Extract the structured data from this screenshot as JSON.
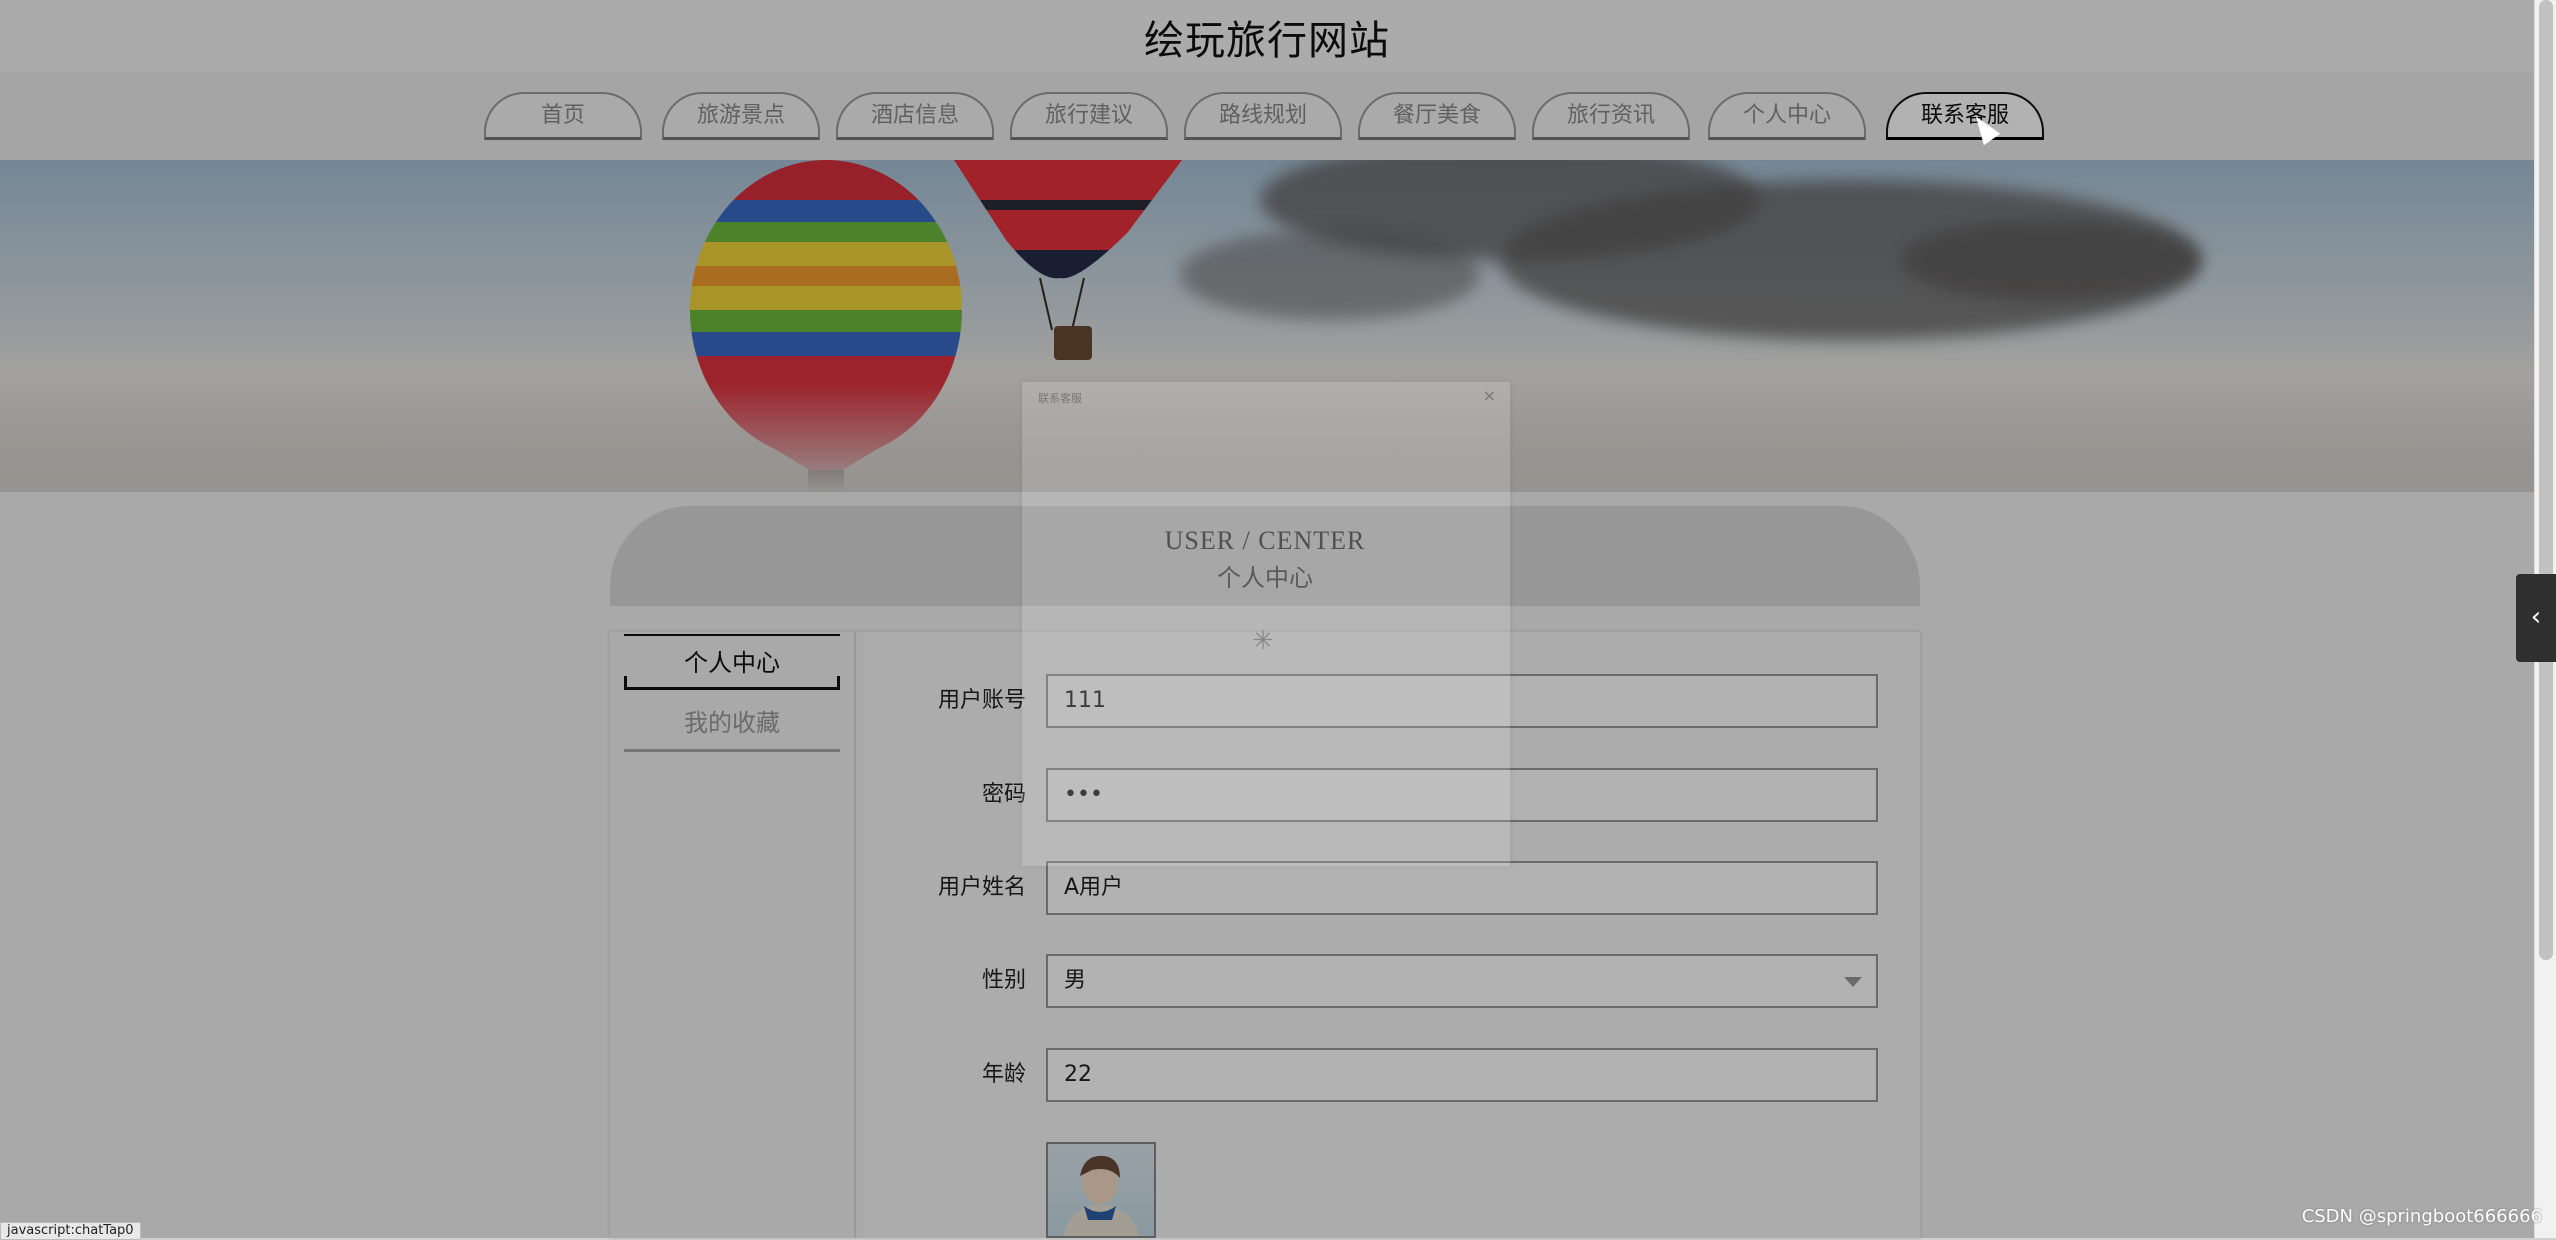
{
  "header": {
    "site_title": "绘玩旅行网站"
  },
  "nav": {
    "items": [
      {
        "label": "首页"
      },
      {
        "label": "旅游景点"
      },
      {
        "label": "酒店信息"
      },
      {
        "label": "旅行建议"
      },
      {
        "label": "路线规划"
      },
      {
        "label": "餐厅美食"
      },
      {
        "label": "旅行资讯"
      },
      {
        "label": "个人中心"
      },
      {
        "label": "联系客服",
        "active": true
      }
    ]
  },
  "center": {
    "title_en": "USER / CENTER",
    "title_cn": "个人中心"
  },
  "side_menu": {
    "items": [
      {
        "label": "个人中心",
        "active": true
      },
      {
        "label": "我的收藏"
      }
    ]
  },
  "form": {
    "account": {
      "label": "用户账号",
      "value": "111"
    },
    "password": {
      "label": "密码",
      "value": "•••"
    },
    "name": {
      "label": "用户姓名",
      "value": "A用户"
    },
    "gender": {
      "label": "性别",
      "value": "男"
    },
    "age": {
      "label": "年龄",
      "value": "22"
    }
  },
  "dialog": {
    "title": "联系客服",
    "close_icon": "close-icon",
    "loading_icon": "spinner-icon"
  },
  "status_bar": {
    "text": "javascript:chatTap0"
  },
  "watermark": {
    "text": "CSDN @springboot666666"
  },
  "side_tab": {
    "icon": "chevron-left-icon",
    "glyph": "‹"
  }
}
